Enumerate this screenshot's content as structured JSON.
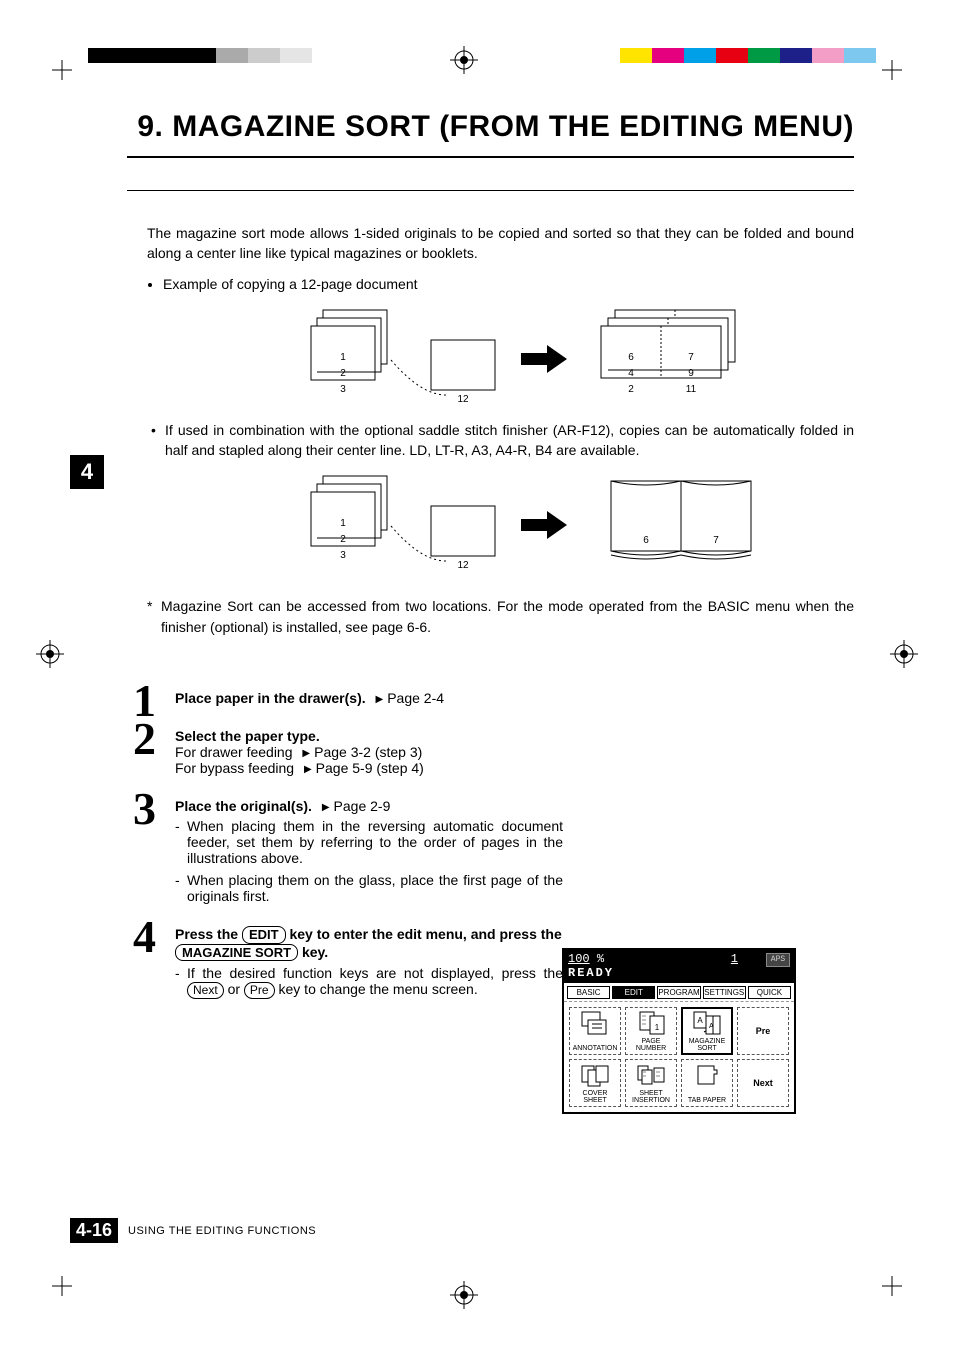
{
  "title": "9. MAGAZINE SORT (FROM THE EDITING MENU)",
  "intro": "The magazine sort mode allows 1-sided originals to be copied and sorted so that they can be folded and bound along a center line like typical magazines or booklets.",
  "example_label": "Example of copying a 12-page document",
  "diag1": {
    "stack": [
      "1",
      "2",
      "3"
    ],
    "single": "12",
    "right": [
      [
        "6",
        "7"
      ],
      [
        "4",
        "9"
      ],
      [
        "2",
        "11"
      ]
    ]
  },
  "bullet_note": "If used in combination with the optional saddle stitch finisher (AR-F12), copies can be automatically folded in half and stapled along their center line.    LD, LT-R, A3, A4-R, B4 are available.",
  "diag2": {
    "stack": [
      "1",
      "2",
      "3"
    ],
    "single": "12",
    "book": [
      "6",
      "7"
    ]
  },
  "star_note": "Magazine Sort can be accessed from two locations. For the mode operated from the BASIC menu when the finisher (optional) is installed, see page 6-6.",
  "chapter_tab": "4",
  "steps": [
    {
      "num": "1",
      "heading": "Place paper in the drawer(s).",
      "ref": "Page 2-4"
    },
    {
      "num": "2",
      "heading": "Select the paper type.",
      "lines": [
        {
          "t": "For drawer feeding",
          "ref": "Page 3-2 (step 3)"
        },
        {
          "t": "For bypass feeding",
          "ref": "Page 5-9 (step 4)"
        }
      ]
    },
    {
      "num": "3",
      "heading": "Place the original(s).",
      "ref": "Page 2-9",
      "subs": [
        "When placing them in the reversing automatic document feeder, set them by referring to the order of pages in the illustrations above.",
        "When placing them on the glass, place the first page of the originals first."
      ]
    },
    {
      "num": "4",
      "heading_pre": "Press the ",
      "key1": "EDIT",
      "heading_mid": " key to enter the edit menu, and press the ",
      "key2": "MAGAZINE SORT",
      "heading_post": " key.",
      "subs": [
        {
          "pre": "If the desired function keys are not displayed, press the ",
          "k1": "Next",
          "mid": " or ",
          "k2": "Pre",
          "post": " key to change the menu screen."
        }
      ]
    }
  ],
  "screen": {
    "ratio": "100",
    "pct": "%",
    "count": "1",
    "aps": "APS",
    "ready": "READY",
    "tabs": [
      "BASIC",
      "EDIT",
      "PROGRAM",
      "SETTINGS",
      "QUICK"
    ],
    "cells_row1": [
      {
        "label": "ANNOTATION"
      },
      {
        "label": "PAGE NUMBER"
      },
      {
        "label": "MAGAZINE SORT",
        "hl": true
      },
      {
        "label": "Pre",
        "side": true
      }
    ],
    "cells_row2": [
      {
        "label": "COVER SHEET"
      },
      {
        "label": "SHEET INSERTION"
      },
      {
        "label": "TAB PAPER"
      },
      {
        "label": "Next",
        "side": true
      }
    ]
  },
  "footer": {
    "page": "4-16",
    "text": "USING THE EDITING FUNCTIONS"
  }
}
